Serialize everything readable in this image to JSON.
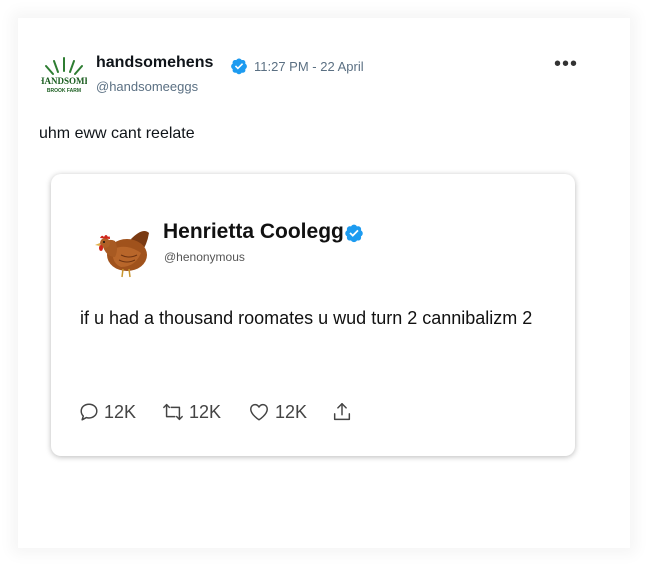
{
  "tweet": {
    "display_name": "handsomehens",
    "handle": "@handsomeeggs",
    "timestamp": "11:27 PM - 22 April",
    "text": "uhm eww cant reelate",
    "logo_text_top": "HANDSOME",
    "logo_text_bottom": "BROOK FARM",
    "more_label": "•••"
  },
  "quoted_tweet": {
    "display_name": "Henrietta Coolegg",
    "handle": "@henonymous",
    "text": "if u had a thousand roomates u wud turn 2 cannibalizm 2",
    "actions": {
      "reply_count": "12K",
      "retweet_count": "12K",
      "like_count": "12K"
    }
  },
  "icons": {
    "verified": "verified-badge-icon",
    "reply": "reply-icon",
    "retweet": "retweet-icon",
    "like": "heart-icon",
    "share": "share-icon",
    "more": "more-dots-icon"
  },
  "colors": {
    "verified_blue": "#1d9bf0",
    "logo_green": "#2e7d32",
    "secondary_text": "#5b7083"
  }
}
